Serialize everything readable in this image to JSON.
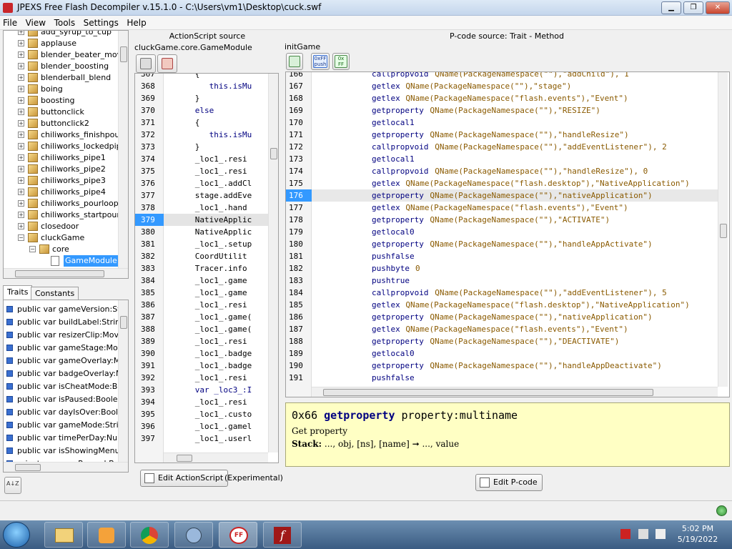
{
  "window": {
    "title": "JPEXS Free Flash Decompiler v.15.1.0 - C:\\Users\\vm1\\Desktop\\cuck.swf",
    "minimize": "▁",
    "maximize": "❐",
    "close": "✕"
  },
  "menu": [
    "File",
    "View",
    "Tools",
    "Settings",
    "Help"
  ],
  "tree": {
    "items": [
      {
        "label": "add_syrup_to_cup",
        "type": "pkg"
      },
      {
        "label": "applause",
        "type": "pkg"
      },
      {
        "label": "blender_beater_move",
        "type": "pkg"
      },
      {
        "label": "blender_boosting",
        "type": "pkg"
      },
      {
        "label": "blenderball_blend",
        "type": "pkg"
      },
      {
        "label": "boing",
        "type": "pkg"
      },
      {
        "label": "boosting",
        "type": "pkg"
      },
      {
        "label": "buttonclick",
        "type": "pkg"
      },
      {
        "label": "buttonclick2",
        "type": "pkg"
      },
      {
        "label": "chiliworks_finishpourin",
        "type": "pkg"
      },
      {
        "label": "chiliworks_lockedpipe",
        "type": "pkg"
      },
      {
        "label": "chiliworks_pipe1",
        "type": "pkg"
      },
      {
        "label": "chiliworks_pipe2",
        "type": "pkg"
      },
      {
        "label": "chiliworks_pipe3",
        "type": "pkg"
      },
      {
        "label": "chiliworks_pipe4",
        "type": "pkg"
      },
      {
        "label": "chiliworks_pourloop",
        "type": "pkg"
      },
      {
        "label": "chiliworks_startpourin",
        "type": "pkg"
      },
      {
        "label": "closedoor",
        "type": "pkg"
      },
      {
        "label": "cluckGame",
        "type": "pkg-open"
      },
      {
        "label": "core",
        "type": "pkg-open-child"
      },
      {
        "label": "GameModule",
        "type": "file-selected"
      }
    ]
  },
  "bottom_tabs": {
    "traits": "Traits",
    "constants": "Constants"
  },
  "traits": [
    "public var gameVersion:Strir",
    "public var buildLabel:String",
    "public var resizerClip:MovieC",
    "public var gameStage:Movie",
    "public var gameOverlay:Mov",
    "public var badgeOverlay:Mc",
    "public var isCheatMode:Boo",
    "public var isPaused:Boolean",
    "public var dayIsOver:Boolea",
    "public var gameMode:String",
    "public var timePerDay:Numb",
    "public var isShowingMenu:Bo",
    "private var wasPaused:Bool"
  ],
  "sort_icon": "A↓Z",
  "actionscript": {
    "header": "ActionScript source",
    "path": "cluckGame.core.GameModule",
    "edit_button": "Edit ActionScript",
    "experimental": "(Experimental)",
    "lines": [
      {
        "n": "367",
        "code": "      {"
      },
      {
        "n": "368",
        "code": "         this.isMu"
      },
      {
        "n": "369",
        "code": "      }"
      },
      {
        "n": "370",
        "code": "      else"
      },
      {
        "n": "371",
        "code": "      {"
      },
      {
        "n": "372",
        "code": "         this.isMu"
      },
      {
        "n": "373",
        "code": "      }"
      },
      {
        "n": "374",
        "code": "      _loc1_.resi"
      },
      {
        "n": "375",
        "code": "      _loc1_.resi"
      },
      {
        "n": "376",
        "code": "      _loc1_.addCl"
      },
      {
        "n": "377",
        "code": "      stage.addEve"
      },
      {
        "n": "378",
        "code": "      _loc1_.hand"
      },
      {
        "n": "379",
        "code": "      NativeApplic",
        "selected": true
      },
      {
        "n": "380",
        "code": "      NativeApplic"
      },
      {
        "n": "381",
        "code": "      _loc1_.setup"
      },
      {
        "n": "382",
        "code": "      CoordUtilit"
      },
      {
        "n": "383",
        "code": "      Tracer.info"
      },
      {
        "n": "384",
        "code": "      _loc1_.game"
      },
      {
        "n": "385",
        "code": "      _loc1_.game"
      },
      {
        "n": "386",
        "code": "      _loc1_.resi"
      },
      {
        "n": "387",
        "code": "      _loc1_.game("
      },
      {
        "n": "388",
        "code": "      _loc1_.game("
      },
      {
        "n": "389",
        "code": "      _loc1_.resi"
      },
      {
        "n": "390",
        "code": "      _loc1_.badge"
      },
      {
        "n": "391",
        "code": "      _loc1_.badge"
      },
      {
        "n": "392",
        "code": "      _loc1_.resi"
      },
      {
        "n": "393",
        "code": "      var _loc3_:I"
      },
      {
        "n": "394",
        "code": "      _loc1_.resi"
      },
      {
        "n": "395",
        "code": "      _loc1_.custo"
      },
      {
        "n": "396",
        "code": "      _loc1_.gamel"
      },
      {
        "n": "397",
        "code": "      _loc1_.userl"
      }
    ]
  },
  "pcode": {
    "header": "P-code source: Trait - Method",
    "method": "initGame",
    "push_label": "push",
    "ff_top": "0xFF",
    "ff_bottom": "FF",
    "edit_button": "Edit P-code",
    "lines": [
      {
        "n": "166",
        "op": "callpropvoid",
        "args": " QName(PackageNamespace(\"\"),\"addChild\"), 1"
      },
      {
        "n": "167",
        "op": "getlex",
        "args": " QName(PackageNamespace(\"\"),\"stage\")"
      },
      {
        "n": "168",
        "op": "getlex",
        "args": " QName(PackageNamespace(\"flash.events\"),\"Event\")"
      },
      {
        "n": "169",
        "op": "getproperty",
        "args": " QName(PackageNamespace(\"\"),\"RESIZE\")"
      },
      {
        "n": "170",
        "op": "getlocal1",
        "args": ""
      },
      {
        "n": "171",
        "op": "getproperty",
        "args": " QName(PackageNamespace(\"\"),\"handleResize\")"
      },
      {
        "n": "172",
        "op": "callpropvoid",
        "args": " QName(PackageNamespace(\"\"),\"addEventListener\"), 2"
      },
      {
        "n": "173",
        "op": "getlocal1",
        "args": ""
      },
      {
        "n": "174",
        "op": "callpropvoid",
        "args": " QName(PackageNamespace(\"\"),\"handleResize\"), 0"
      },
      {
        "n": "175",
        "op": "getlex",
        "args": " QName(PackageNamespace(\"flash.desktop\"),\"NativeApplication\")"
      },
      {
        "n": "176",
        "op": "getproperty",
        "args": " QName(PackageNamespace(\"\"),\"nativeApplication\")",
        "selected": true
      },
      {
        "n": "177",
        "op": "getlex",
        "args": " QName(PackageNamespace(\"flash.events\"),\"Event\")"
      },
      {
        "n": "178",
        "op": "getproperty",
        "args": " QName(PackageNamespace(\"\"),\"ACTIVATE\")"
      },
      {
        "n": "179",
        "op": "getlocal0",
        "args": ""
      },
      {
        "n": "180",
        "op": "getproperty",
        "args": " QName(PackageNamespace(\"\"),\"handleAppActivate\")"
      },
      {
        "n": "181",
        "op": "pushfalse",
        "args": ""
      },
      {
        "n": "182",
        "op": "pushbyte",
        "args": " 0"
      },
      {
        "n": "183",
        "op": "pushtrue",
        "args": ""
      },
      {
        "n": "184",
        "op": "callpropvoid",
        "args": " QName(PackageNamespace(\"\"),\"addEventListener\"), 5"
      },
      {
        "n": "185",
        "op": "getlex",
        "args": " QName(PackageNamespace(\"flash.desktop\"),\"NativeApplication\")"
      },
      {
        "n": "186",
        "op": "getproperty",
        "args": " QName(PackageNamespace(\"\"),\"nativeApplication\")"
      },
      {
        "n": "187",
        "op": "getlex",
        "args": " QName(PackageNamespace(\"flash.events\"),\"Event\")"
      },
      {
        "n": "188",
        "op": "getproperty",
        "args": " QName(PackageNamespace(\"\"),\"DEACTIVATE\")"
      },
      {
        "n": "189",
        "op": "getlocal0",
        "args": ""
      },
      {
        "n": "190",
        "op": "getproperty",
        "args": " QName(PackageNamespace(\"\"),\"handleAppDeactivate\")"
      },
      {
        "n": "191",
        "op": "pushfalse",
        "args": ""
      }
    ]
  },
  "doc": {
    "opcode": "0x66",
    "name": "getproperty",
    "signature": "property:multiname",
    "description": "Get property",
    "stack_label": "Stack:",
    "stack_value": "..., obj, [ns], [name] ➞ ..., value"
  },
  "clock": {
    "time": "5:02 PM",
    "date": "5/19/2022"
  },
  "colors": {
    "accent": "#3399ff",
    "doc_bg": "#ffffc4",
    "keyword": "#000080"
  }
}
